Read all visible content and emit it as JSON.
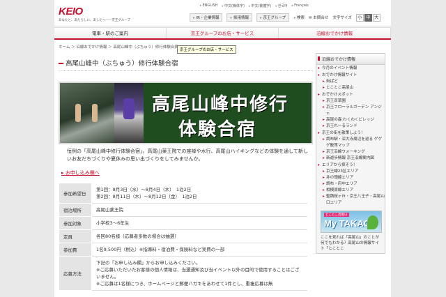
{
  "header": {
    "logo": "KEIO",
    "tagline": "あなたと、あたらしい、あしたへ――京王グループ",
    "languages": [
      "ENGLISH",
      "中文(簡体字)",
      "中文(繁體字)",
      "한국어",
      "Français"
    ],
    "util_links": [
      "IR・企業情報",
      "採用情報",
      "京王グループ"
    ],
    "search": "検索",
    "contact": "お問合せ",
    "font_size_label": "文字サイズ",
    "font_sizes": [
      "小",
      "中",
      "大"
    ]
  },
  "nav": {
    "items": [
      "電車・駅のご案内",
      "京王グループのお店・サービス",
      "沿線おでかけ情報"
    ]
  },
  "breadcrumb": "ホーム ＞ 沿線おでかけ情報 ＞ 高尾山峰中（ぶちゅう）修行体験合宿",
  "tooltip": "京王グループのお店・サービス",
  "main": {
    "title": "高尾山峰中（ぶちゅう）修行体験合宿",
    "banner_line1": "高尾山峰中修行",
    "banner_line2": "体験合宿",
    "intro": "恒例の「高尾山峰中修行体験合宿」。高尾山薬王院での座禅や水行、高尾山ハイキングなどの体験を通して新しいお友だちづくりや夏休みの思い出づくりをしてみませんか。",
    "apply_link": "お申し込み欄へ",
    "table": {
      "rows": [
        {
          "label": "参加希望日",
          "lines": [
            "第1回：8月3日（水）〜8月4日（木）　1泊2日",
            "第2回：8月11日（木）〜8月12日（金）　1泊2日"
          ]
        },
        {
          "label": "宿泊場所",
          "lines": [
            "高尾山薬王院"
          ]
        },
        {
          "label": "参加対象",
          "lines": [
            "小学校3〜6年生"
          ]
        },
        {
          "label": "定員",
          "lines": [
            "各回80名様（応募者多数の場合は抽選）"
          ]
        },
        {
          "label": "参加費",
          "lines": [
            "1名9,500円（税込）※指導料・宿泊費・保険料など実費の一部"
          ]
        },
        {
          "label": "応募方法",
          "lines": [
            "下記の「お申し込み欄」からお申し込みください。",
            "※ご応募いただいたお客様の個人情報は、当選通知及び当イベント以外の目的で使用することはございません。",
            "※ご応募は1名様につき、ホームページと郵便ハガキをあわせて1件とし、重複応募は無"
          ]
        }
      ]
    }
  },
  "sidebar": {
    "head": "沿線おでかけ情報",
    "items": [
      {
        "type": "sec",
        "text": "今月のイベント情報"
      },
      {
        "type": "sec",
        "text": "おでかけ情報サイト"
      },
      {
        "type": "sub",
        "text": "街ぱど"
      },
      {
        "type": "sub",
        "text": "とことこ高尾山"
      },
      {
        "type": "sec",
        "text": "おでかけスポット"
      },
      {
        "type": "sub",
        "text": "京王百草園"
      },
      {
        "type": "sub",
        "text": "京王フローラルガーデン アンジェ"
      },
      {
        "type": "sub",
        "text": "高尾の森 わくわくビレッジ"
      },
      {
        "type": "sub",
        "text": "京王れーるランド"
      },
      {
        "type": "sec",
        "text": "京王の街を散策しよう！"
      },
      {
        "type": "sub",
        "text": "調布駅・深大寺周辺を巡る ゲゲゲ散策マップ"
      },
      {
        "type": "sub",
        "text": "京王沿線ウォーキング"
      },
      {
        "type": "sub",
        "text": "新遊歩情報 京王沿線案内図"
      },
      {
        "type": "sec",
        "text": "エリアから探そう！"
      },
      {
        "type": "sub",
        "text": "京王線23区エリア"
      },
      {
        "type": "sub",
        "text": "井の頭線エリア"
      },
      {
        "type": "sub",
        "text": "調布・府中エリア"
      },
      {
        "type": "sub",
        "text": "相模原線エリア"
      },
      {
        "type": "sub",
        "text": "聖蹟桜ヶ丘・京王八王子・高尾山口エリア"
      }
    ],
    "banner_small": "とことこ高尾山",
    "banner_big": "My TAKAO",
    "desc": "ここを見れば「高尾山」のことが何でもわかる？高尾山の情報サイト「とことこ"
  }
}
